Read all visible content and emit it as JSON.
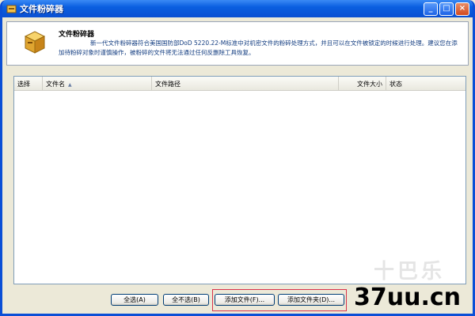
{
  "window": {
    "title": "文件粉碎器",
    "controls": {
      "minimize": "_",
      "maximize": "□",
      "close": "×"
    }
  },
  "header": {
    "title": "文件粉碎器",
    "description": "新一代文件粉碎器符合美国国防部DoD 5220.22-M标准中对机密文件的粉碎处理方式，并且可以在文件被锁定的时候进行处理。建议您在添加待粉碎对象时谨慎操作，被粉碎的文件将无法通过任何反删除工具恢复。"
  },
  "list": {
    "columns": [
      "选择",
      "文件名",
      "文件路径",
      "文件大小",
      "状态"
    ],
    "sort_indicator": "▲"
  },
  "buttons": {
    "select_all": "全选(A)",
    "select_none": "全不选(B)",
    "add_file": "添加文件(F)...",
    "add_folder": "添加文件夹(D)..."
  },
  "watermark": {
    "text": "37uu.cn",
    "faint_text": "十巴乐"
  },
  "colors": {
    "titlebar": "#0a5fe0",
    "highlight": "#d9324a",
    "desc_text": "#123c80"
  }
}
